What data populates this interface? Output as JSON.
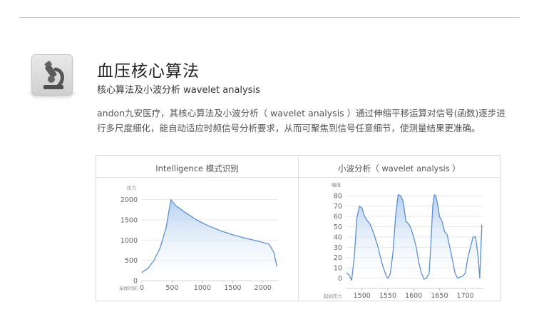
{
  "title": "血压核心算法",
  "subtitle": "核心算法及小波分析 wavelet analysis",
  "description": "andon九安医疗，其核心算法及小波分析（ wavelet analysis ）通过伸缩平移运算对信号(函数)逐步进行多尺度细化，能自动适应时频信号分析要求，从而可聚焦到信号任意细节，使测量结果更准确。",
  "icon": "microscope-icon",
  "colors": {
    "line": "#5e8fcf",
    "fill_top": "#a8c8ee",
    "fill_bottom": "#ffffff",
    "grid": "#e8e8e8"
  },
  "panel": {
    "left_title": "Intelligence 模式识别",
    "right_title": "小波分析（ wavelet analysis ）"
  },
  "chart_data": [
    {
      "type": "area",
      "ylabel": "压力",
      "xlabel": "采样时间",
      "xlim": [
        0,
        2250
      ],
      "ylim": [
        0,
        2150
      ],
      "x_ticks": [
        0,
        500,
        1000,
        1500,
        2000
      ],
      "y_ticks": [
        0,
        500,
        1000,
        1500,
        2000
      ],
      "grid": true,
      "x": [
        0,
        100,
        200,
        300,
        400,
        480,
        560,
        700,
        900,
        1100,
        1300,
        1500,
        1700,
        1900,
        2100,
        2180,
        2230
      ],
      "values": [
        200,
        300,
        500,
        800,
        1300,
        2000,
        1850,
        1700,
        1500,
        1350,
        1230,
        1130,
        1050,
        980,
        900,
        700,
        350
      ]
    },
    {
      "type": "area",
      "ylabel": "幅值",
      "xlabel": "起始压力",
      "xlim": [
        1470,
        1735
      ],
      "ylim": [
        -10,
        85
      ],
      "x_ticks": [
        1500,
        1550,
        1600,
        1650,
        1700
      ],
      "y_ticks": [
        0,
        10,
        20,
        30,
        40,
        50,
        60,
        70,
        80
      ],
      "grid": true,
      "x": [
        1470,
        1475,
        1480,
        1485,
        1490,
        1495,
        1500,
        1505,
        1510,
        1515,
        1520,
        1525,
        1530,
        1535,
        1540,
        1545,
        1548,
        1551,
        1555,
        1560,
        1565,
        1570,
        1575,
        1580,
        1585,
        1590,
        1595,
        1600,
        1605,
        1610,
        1615,
        1620,
        1625,
        1630,
        1633,
        1637,
        1640,
        1643,
        1647,
        1650,
        1655,
        1660,
        1665,
        1670,
        1675,
        1680,
        1685,
        1690,
        1695,
        1700,
        1705,
        1710,
        1715,
        1720,
        1725,
        1728,
        1732
      ],
      "values": [
        5,
        3,
        -2,
        20,
        58,
        70,
        68,
        60,
        56,
        53,
        47,
        40,
        32,
        22,
        12,
        5,
        1,
        0,
        5,
        25,
        60,
        81,
        80,
        74,
        55,
        53,
        48,
        40,
        30,
        15,
        5,
        -1,
        0,
        5,
        30,
        70,
        81,
        80,
        70,
        60,
        55,
        45,
        42,
        30,
        18,
        5,
        0,
        1,
        2,
        5,
        20,
        30,
        40,
        40,
        20,
        0,
        52
      ]
    }
  ]
}
